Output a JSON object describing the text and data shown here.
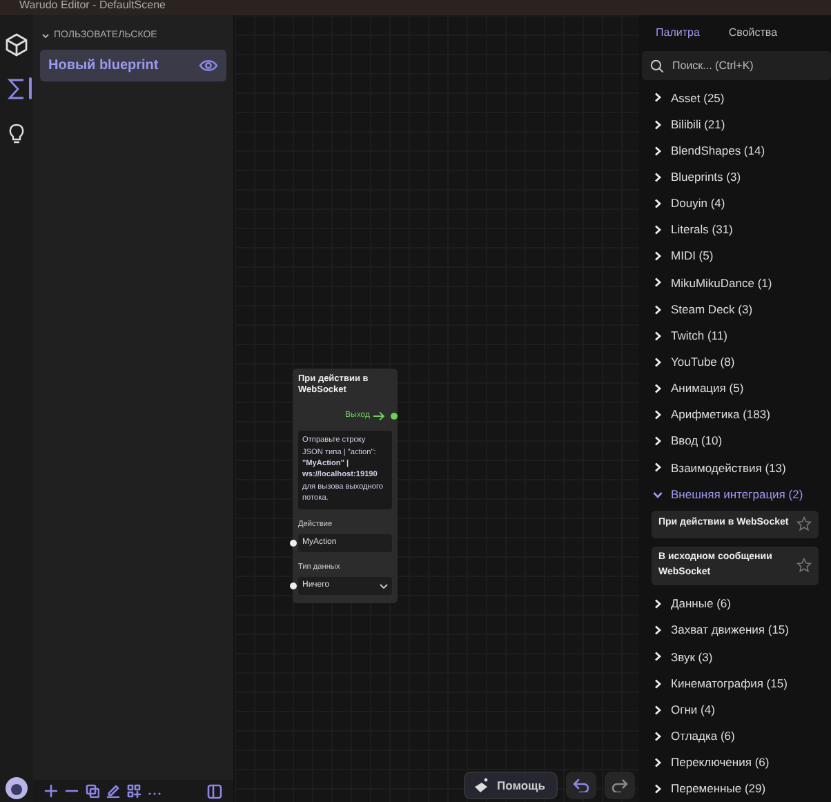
{
  "window": {
    "title": "Warudo Editor - DefaultScene"
  },
  "rail": [
    {
      "kind": "cube",
      "selected": false
    },
    {
      "kind": "sigma",
      "selected": true
    },
    {
      "kind": "bulb",
      "selected": false
    }
  ],
  "sidebar": {
    "section_label": "ПОЛЬЗОВАТЕЛЬСКОЕ",
    "section_expanded": true,
    "items": [
      {
        "label": "Новый blueprint",
        "selected": true
      }
    ]
  },
  "node": {
    "title": "При действии в WebSocket",
    "output_label": "Выход",
    "description": "Отправьте строку JSON типа | \"action\": **\"MyAction\" | ws://localhost:19190** для вызова выходного потока.",
    "fields": [
      {
        "kind": "text",
        "label": "Действие",
        "value": "MyAction"
      },
      {
        "kind": "select",
        "label": "Тип данных",
        "value": "Ничего"
      }
    ]
  },
  "help_button": {
    "label": "Помощь"
  },
  "right_panel": {
    "tabs": [
      {
        "label": "Палитра",
        "selected": true
      },
      {
        "label": "Свойства",
        "selected": false
      }
    ],
    "search": {
      "placeholder": "Поиск... (Ctrl+K)"
    },
    "categories": [
      {
        "label": "Asset (25)",
        "expanded": false
      },
      {
        "label": "Bilibili (21)",
        "expanded": false
      },
      {
        "label": "BlendShapes (14)",
        "expanded": false
      },
      {
        "label": "Blueprints (3)",
        "expanded": false
      },
      {
        "label": "Douyin (4)",
        "expanded": false
      },
      {
        "label": "Literals (31)",
        "expanded": false
      },
      {
        "label": "MIDI (5)",
        "expanded": false
      },
      {
        "label": "MikuMikuDance (1)",
        "expanded": false
      },
      {
        "label": "Steam Deck (3)",
        "expanded": false
      },
      {
        "label": "Twitch (11)",
        "expanded": false
      },
      {
        "label": "YouTube (8)",
        "expanded": false
      },
      {
        "label": "Анимация (5)",
        "expanded": false
      },
      {
        "label": "Арифметика (183)",
        "expanded": false
      },
      {
        "label": "Ввод (10)",
        "expanded": false
      },
      {
        "label": "Взаимодействия (13)",
        "expanded": false
      },
      {
        "label": "Внешняя интеграция (2)",
        "expanded": true,
        "children": [
          {
            "label": "При действии в WebSocket",
            "starred": false
          },
          {
            "label": "В исходном сообщении WebSocket",
            "starred": false
          }
        ]
      },
      {
        "label": "Данные (6)",
        "expanded": false
      },
      {
        "label": "Захват движения (15)",
        "expanded": false
      },
      {
        "label": "Звук (3)",
        "expanded": false
      },
      {
        "label": "Кинематография (15)",
        "expanded": false
      },
      {
        "label": "Огни (4)",
        "expanded": false
      },
      {
        "label": "Отладка (6)",
        "expanded": false
      },
      {
        "label": "Переключения (6)",
        "expanded": false
      },
      {
        "label": "Переменные (29)",
        "expanded": false
      }
    ]
  }
}
